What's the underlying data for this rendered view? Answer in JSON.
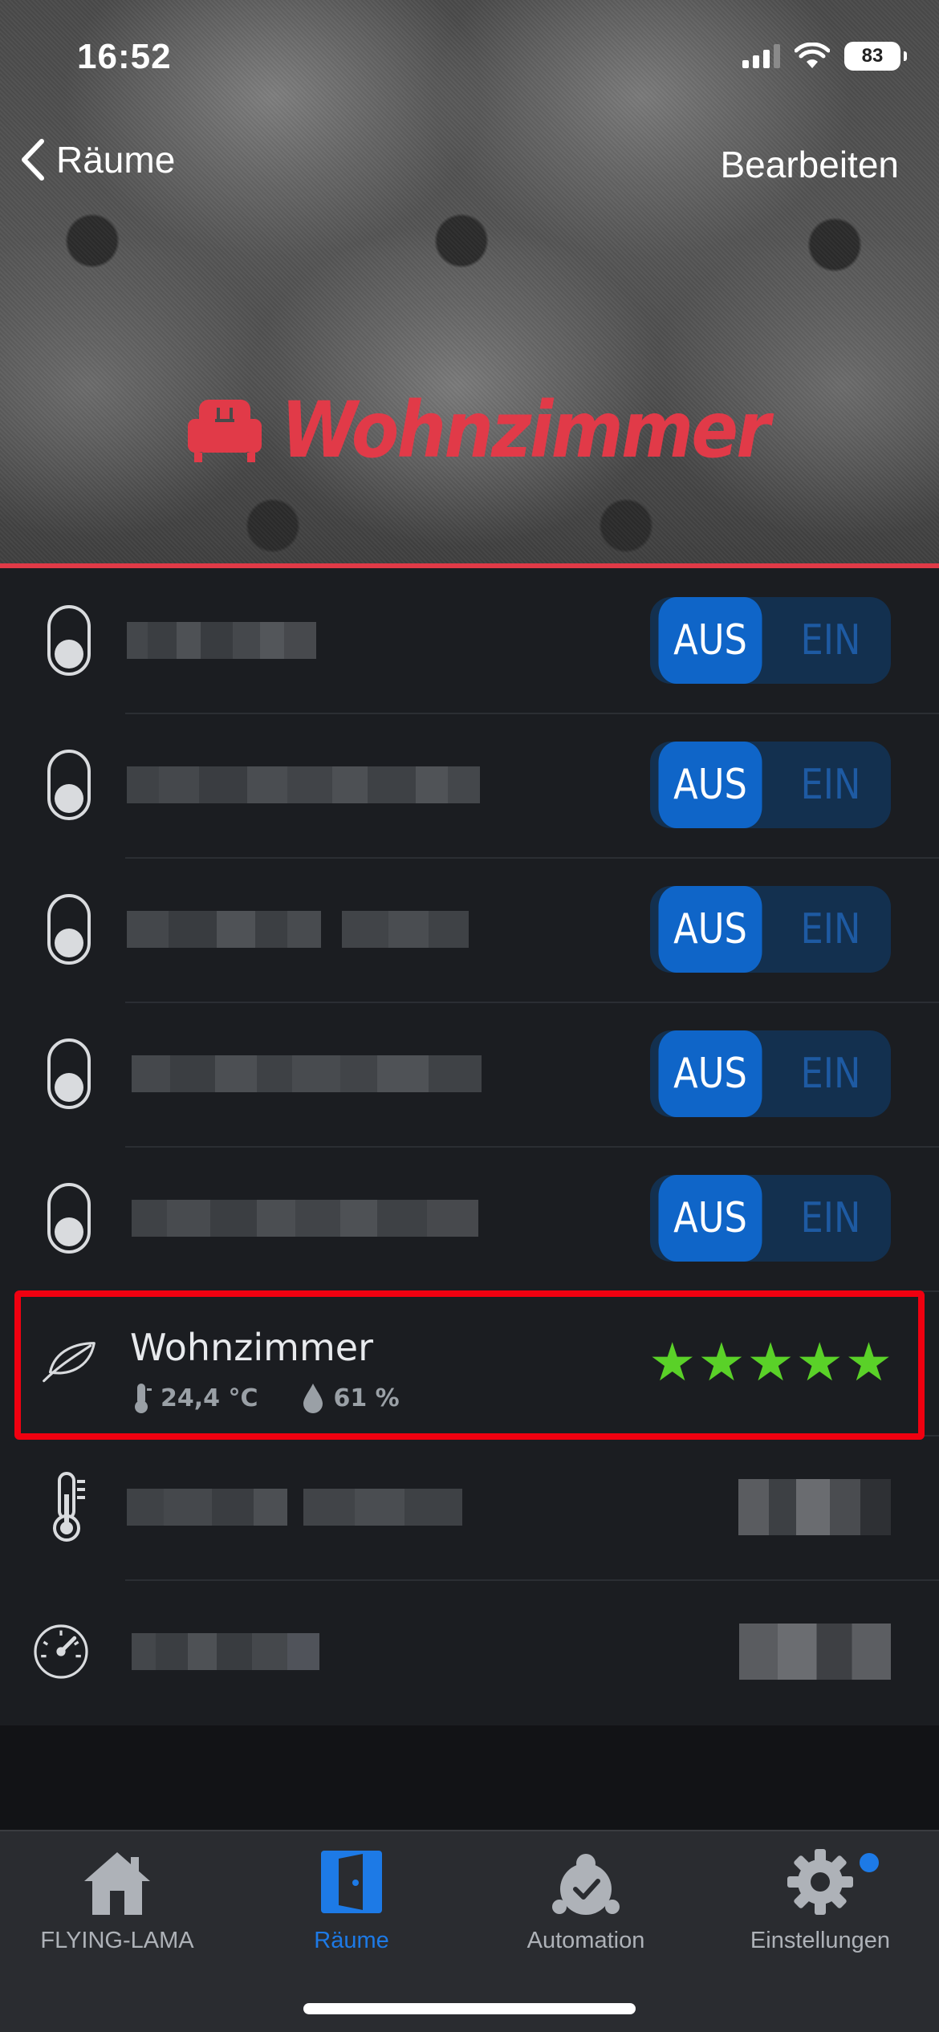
{
  "status_bar": {
    "time": "16:52",
    "battery": "83"
  },
  "nav": {
    "back_label": "Räume",
    "edit_label": "Bearbeiten"
  },
  "room": {
    "title": "Wohnzimmer",
    "accent_color": "#e13a48",
    "icon": "armchair-icon"
  },
  "switches": [
    {
      "off_label": "AUS",
      "on_label": "EIN",
      "state": "AUS"
    },
    {
      "off_label": "AUS",
      "on_label": "EIN",
      "state": "AUS"
    },
    {
      "off_label": "AUS",
      "on_label": "EIN",
      "state": "AUS"
    },
    {
      "off_label": "AUS",
      "on_label": "EIN",
      "state": "AUS"
    },
    {
      "off_label": "AUS",
      "on_label": "EIN",
      "state": "AUS"
    }
  ],
  "climate": {
    "name": "Wohnzimmer",
    "temperature": "24,4 °C",
    "humidity": "61 %",
    "rating": 5,
    "star_color": "#5ad128"
  },
  "tabs": [
    {
      "label": "FLYING-LAMA",
      "icon": "house-icon",
      "active": false
    },
    {
      "label": "Räume",
      "icon": "door-icon",
      "active": true
    },
    {
      "label": "Automation",
      "icon": "alarm-clock-icon",
      "active": false
    },
    {
      "label": "Einstellungen",
      "icon": "gear-icon",
      "active": false,
      "badge": true
    }
  ]
}
